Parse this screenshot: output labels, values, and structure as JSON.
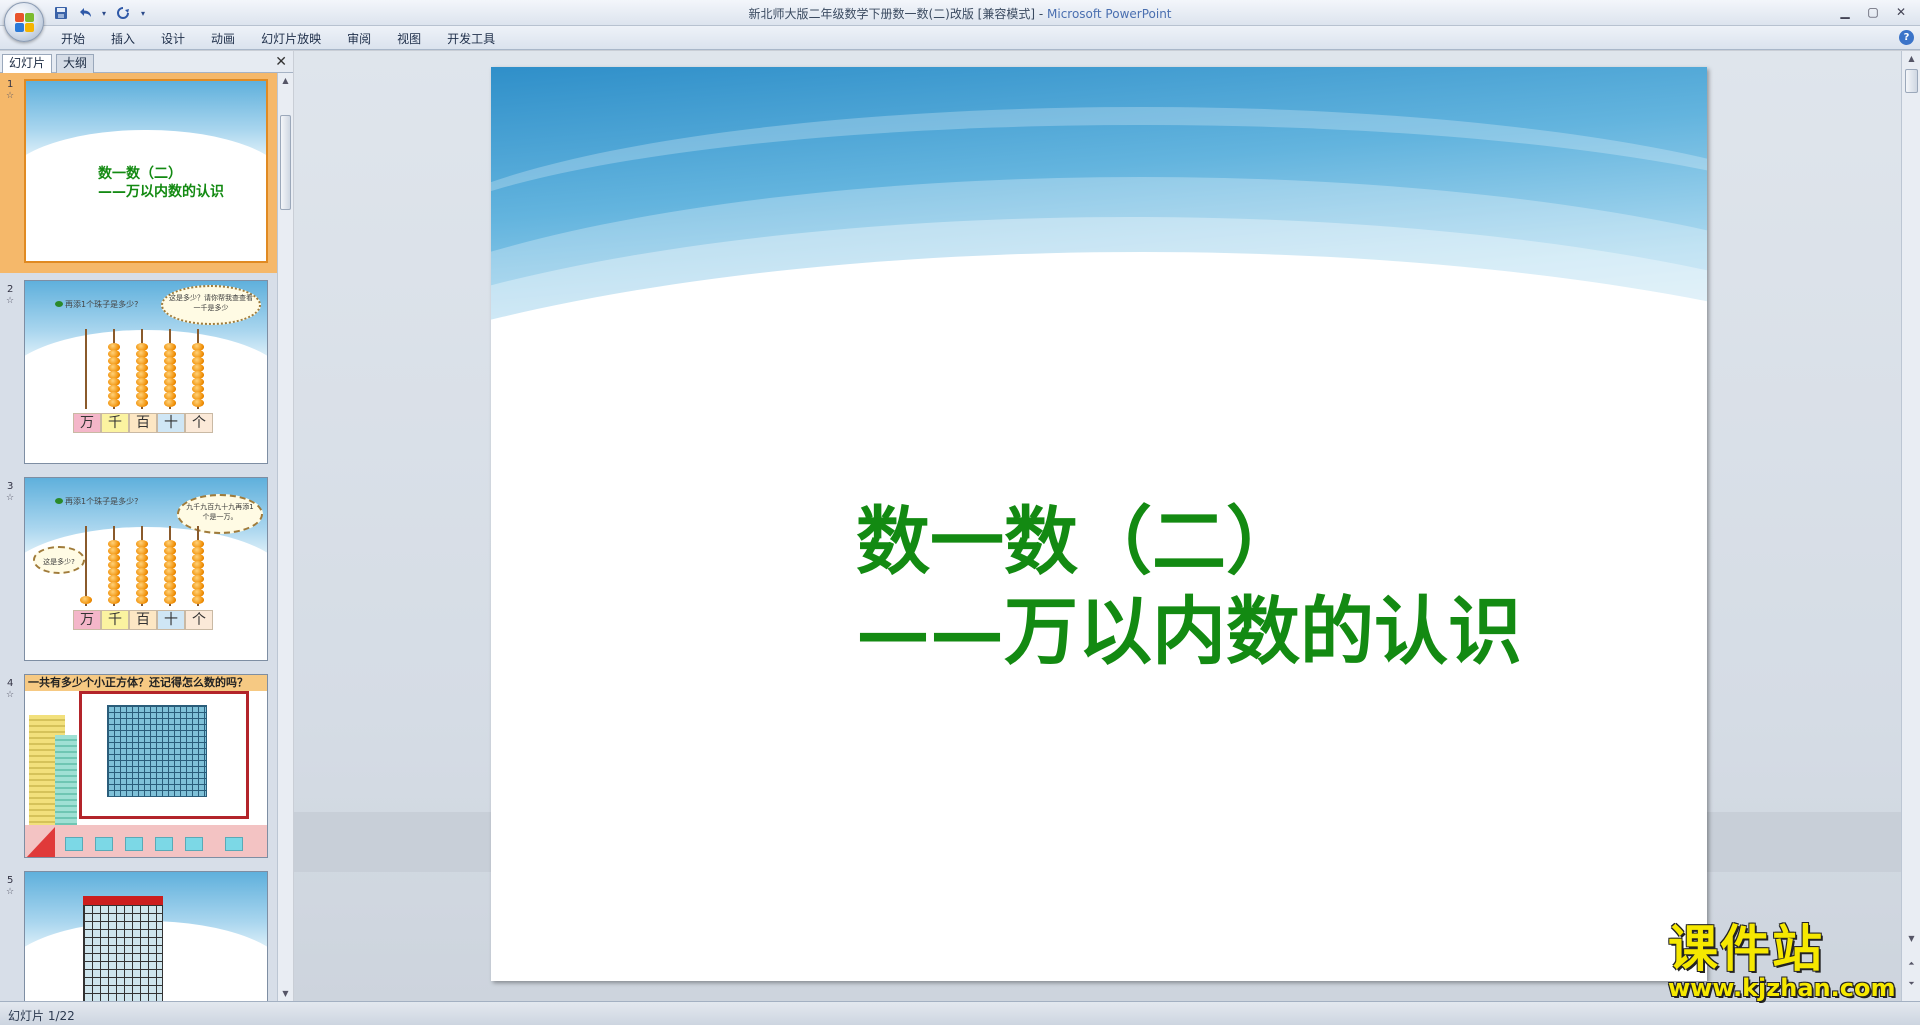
{
  "window": {
    "title": "新北师大版二年级数学下册数一数(二)改版 [兼容模式]",
    "title_separator": " - ",
    "app_name": "Microsoft PowerPoint"
  },
  "quick_access": {
    "save_icon": "save-icon",
    "undo_icon": "undo-icon",
    "redo_icon": "redo-icon"
  },
  "ribbon": {
    "tabs": [
      {
        "label": "开始"
      },
      {
        "label": "插入"
      },
      {
        "label": "设计"
      },
      {
        "label": "动画"
      },
      {
        "label": "幻灯片放映"
      },
      {
        "label": "审阅"
      },
      {
        "label": "视图"
      },
      {
        "label": "开发工具"
      }
    ],
    "help_label": "?"
  },
  "left_panel": {
    "tabs": [
      {
        "label": "幻灯片",
        "active": true
      },
      {
        "label": "大纲",
        "active": false
      }
    ],
    "close_label": "✕",
    "thumbnails": [
      {
        "number": "1",
        "title_line1": "数一数（二）",
        "title_line2": "——万以内数的认识"
      },
      {
        "number": "2",
        "question": "再添1个珠子是多少?",
        "bubble": "这是多少？请你帮我查查看一千是多少",
        "places": [
          "万",
          "千",
          "百",
          "十",
          "个"
        ]
      },
      {
        "number": "3",
        "question": "再添1个珠子是多少?",
        "bubble_right": "九千九百九十九再添1个是一万。",
        "bubble_left": "这是多少?",
        "places": [
          "万",
          "千",
          "百",
          "十",
          "个"
        ]
      },
      {
        "number": "4",
        "header": "一共有多少个小正方体？还记得怎么数的吗？"
      },
      {
        "number": "5"
      }
    ]
  },
  "slide": {
    "title_line1": "数一数（二）",
    "title_line2": "——万以内数的认识",
    "title_color": "#138a12"
  },
  "watermark": {
    "text": "课件站",
    "url": "www.kjzhan.com"
  },
  "status": {
    "slide_counter": "幻灯片 1/22"
  },
  "colors": {
    "accent_green": "#138a12",
    "selection_orange": "#f5b86a",
    "watermark_yellow": "#f6e800"
  }
}
